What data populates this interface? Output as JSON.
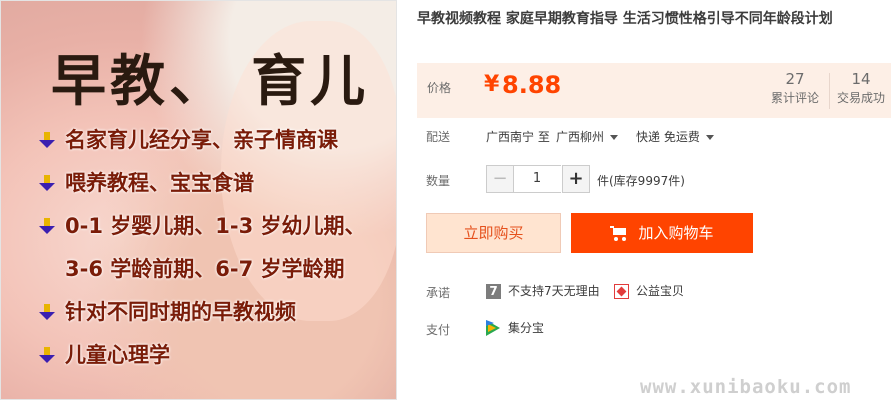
{
  "image": {
    "headline": "早教、 育儿",
    "bullets": [
      "名家育儿经分享、亲子情商课",
      "喂养教程、宝宝食谱",
      "0-1 岁婴儿期、1-3 岁幼儿期、",
      "3-6 学龄前期、6-7 岁学龄期",
      "针对不同时期的早教视频",
      "儿童心理学"
    ]
  },
  "product": {
    "title": "早教视频教程 家庭早期教育指导 生活习惯性格引导不同年龄段计划"
  },
  "price": {
    "label": "价格",
    "currency": "¥",
    "value": "8.88",
    "reviews_count": "27",
    "reviews_label": "累计评论",
    "sales_count": "14",
    "sales_label": "交易成功"
  },
  "shipping": {
    "label": "配送",
    "from": "广西南宁 至",
    "to": "广西柳州",
    "method": "快递 免运费"
  },
  "quantity": {
    "label": "数量",
    "value": "1",
    "minus": "−",
    "plus": "+",
    "stock": "件(库存9997件)"
  },
  "actions": {
    "buy_now": "立即购买",
    "add_cart": "加入购物车"
  },
  "promise": {
    "label": "承诺",
    "icon_seven": "7",
    "no_return": "不支持7天无理由",
    "charity": "公益宝贝"
  },
  "payment": {
    "label": "支付",
    "method": "集分宝"
  },
  "watermark": "www.xunibaoku.com",
  "colors": {
    "accent": "#ff4400",
    "price_bg": "#fdefe6",
    "buy_now_bg": "#ffe4d0"
  }
}
